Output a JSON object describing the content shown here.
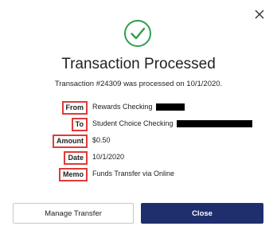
{
  "dialog": {
    "title": "Transaction Processed",
    "subtitle": "Transaction #24309 was processed on 10/1/2020."
  },
  "details": [
    {
      "label": "From",
      "value": "Rewards Checking",
      "redacted": true
    },
    {
      "label": "To",
      "value": "Student Choice Checking",
      "redacted": true
    },
    {
      "label": "Amount",
      "value": "$0.50",
      "redacted": false
    },
    {
      "label": "Date",
      "value": "10/1/2020",
      "redacted": false
    },
    {
      "label": "Memo",
      "value": "Funds Transfer via Online",
      "redacted": false
    }
  ],
  "buttons": {
    "manage_label": "Manage Transfer",
    "close_label": "Close"
  },
  "colors": {
    "success": "#2e9e4f",
    "primary": "#1f2f6e",
    "highlight": "#e03a3a"
  },
  "icons": {
    "close": "close-icon",
    "success": "checkmark-circle-icon"
  }
}
